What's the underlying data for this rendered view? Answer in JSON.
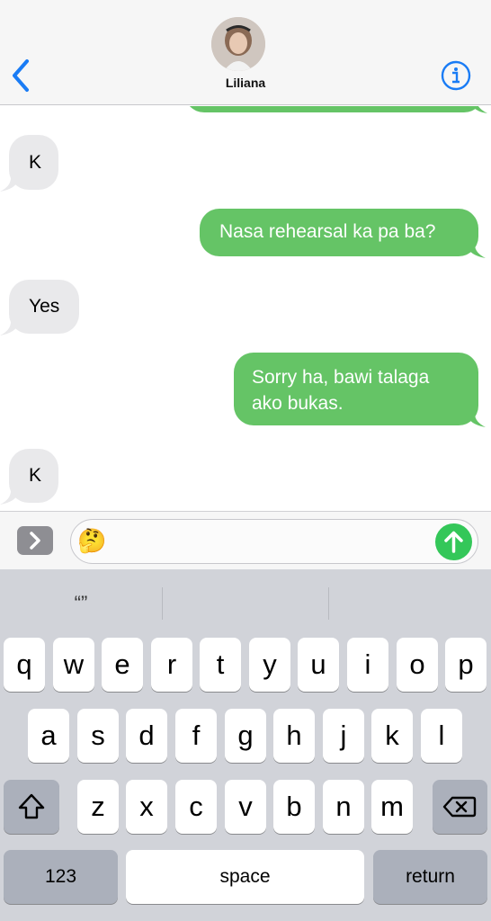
{
  "header": {
    "contact_name": "Liliana"
  },
  "messages": [
    {
      "direction": "in",
      "text": "K"
    },
    {
      "direction": "out",
      "text": "Nasa rehearsal ka pa ba?"
    },
    {
      "direction": "in",
      "text": "Yes"
    },
    {
      "direction": "out",
      "line1": "Sorry ha, bawi talaga",
      "line2": "ako bukas."
    },
    {
      "direction": "in",
      "text": "K"
    }
  ],
  "composer": {
    "text": "🤔"
  },
  "keyboard": {
    "suggestions": [
      "“”",
      "",
      ""
    ],
    "row1": [
      "q",
      "w",
      "e",
      "r",
      "t",
      "y",
      "u",
      "i",
      "o",
      "p"
    ],
    "row2": [
      "a",
      "s",
      "d",
      "f",
      "g",
      "h",
      "j",
      "k",
      "l"
    ],
    "row3": [
      "z",
      "x",
      "c",
      "v",
      "b",
      "n",
      "m"
    ],
    "numbers_label": "123",
    "space_label": "space",
    "return_label": "return"
  },
  "colors": {
    "outgoing_bubble": "#65c466",
    "incoming_bubble": "#e9e9eb",
    "accent": "#1a7cf5",
    "send_button": "#34c759"
  }
}
